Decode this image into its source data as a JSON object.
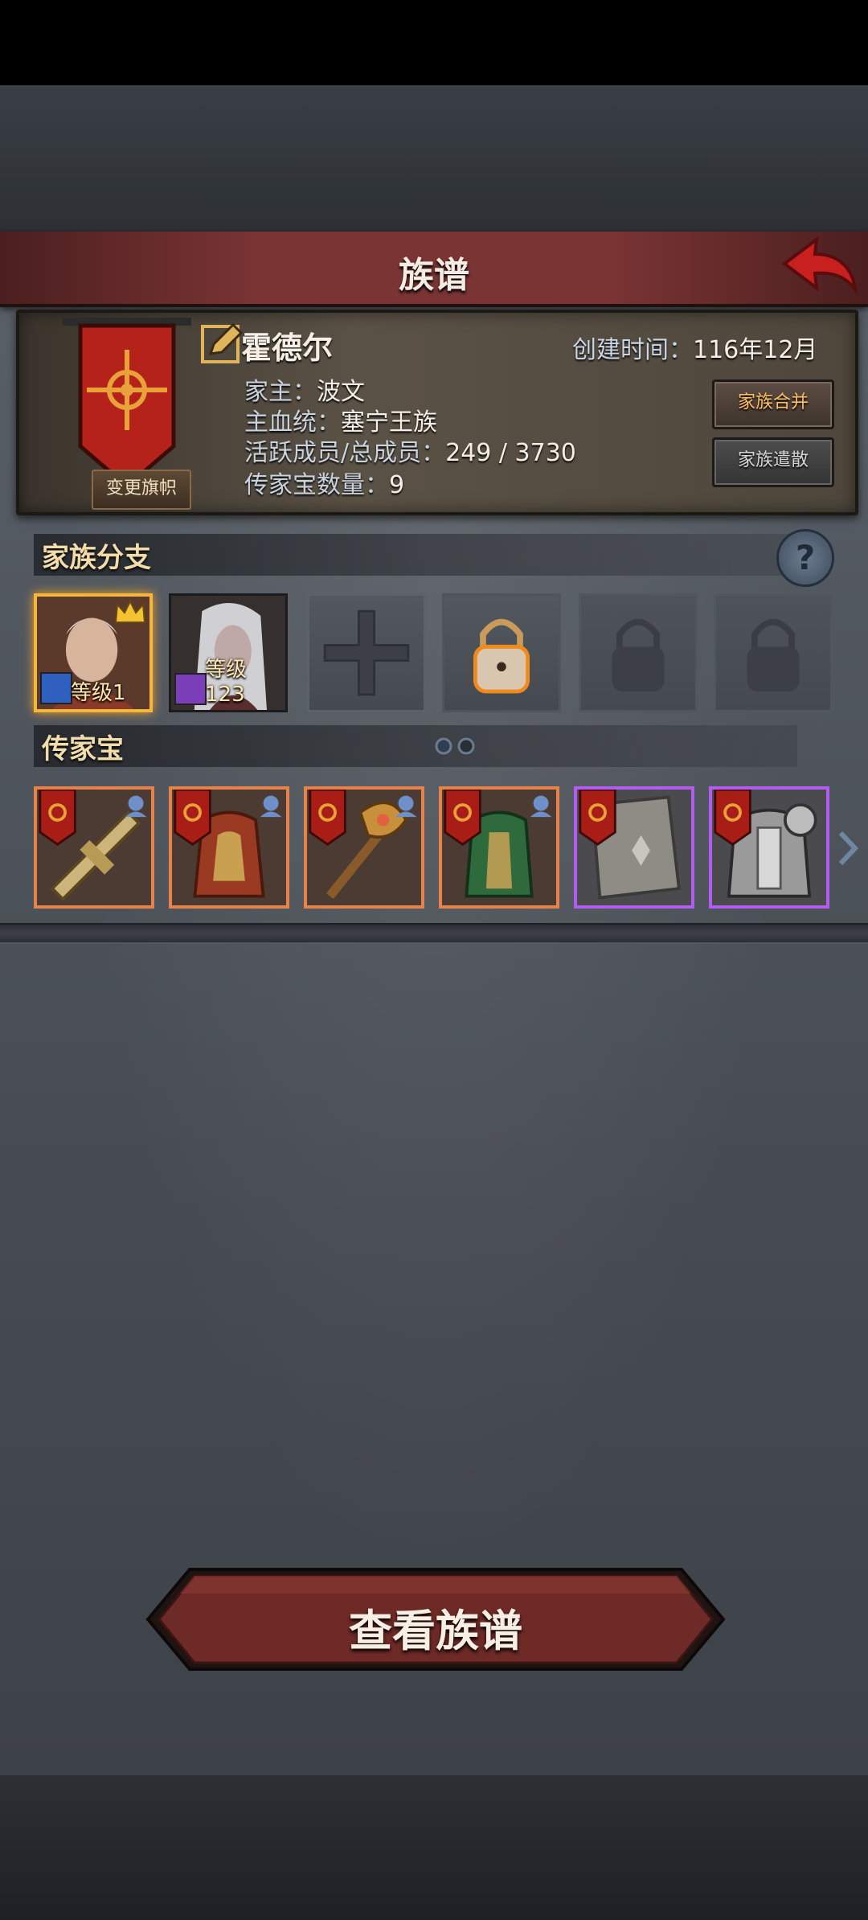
{
  "header": {
    "title": "族谱"
  },
  "family": {
    "name": "霍德尔",
    "created_label": "创建时间：",
    "created_value": "116年12月",
    "head_key": "家主：",
    "head_value": "波文",
    "bloodline_key": "主血统：",
    "bloodline_value": "塞宁王族",
    "members_key": "活跃成员/总成员：",
    "members_value": "249 / 3730",
    "heirlooms_key": "传家宝数量：",
    "heirlooms_value": "9",
    "change_banner_label": "变更旗帜",
    "merge_label": "家族合并",
    "disband_label": "家族遣散"
  },
  "branches": {
    "title": "家族分支",
    "heroes": [
      {
        "level": "等级1"
      },
      {
        "level": "等级123"
      }
    ]
  },
  "heirlooms": {
    "title": "传家宝"
  },
  "footer": {
    "view_label": "查看族谱"
  },
  "colors": {
    "header": "#7a3434",
    "legendary_border": "#e5834a",
    "epic_border": "#b35cf0",
    "section_title": "#f1dcaa",
    "merge_text": "#ffbf64"
  }
}
